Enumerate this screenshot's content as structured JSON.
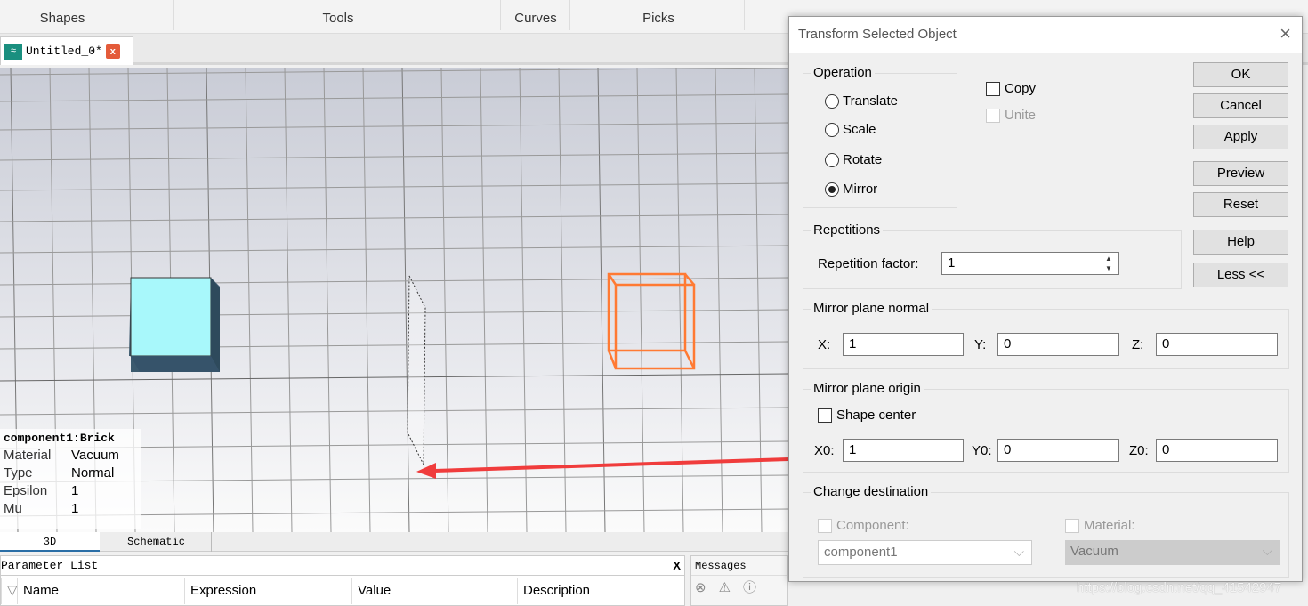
{
  "ribbon": {
    "groups": [
      "Shapes",
      "Tools",
      "Curves",
      "Picks"
    ]
  },
  "document_tab": {
    "title": "Untitled_0*",
    "close": "x"
  },
  "info_panel": {
    "title": "component1:Brick",
    "rows": [
      {
        "k": "Material",
        "v": "Vacuum"
      },
      {
        "k": "Type",
        "v": "Normal"
      },
      {
        "k": "Epsilon",
        "v": "1"
      },
      {
        "k": "Mu",
        "v": "1"
      }
    ]
  },
  "view_tabs": [
    "3D",
    "Schematic"
  ],
  "parameter_list": {
    "title": "Parameter List",
    "close": "X",
    "columns": [
      "Name",
      "Expression",
      "Value",
      "Description"
    ]
  },
  "messages": {
    "title": "Messages"
  },
  "colors": {
    "brick": "#a8f8fb",
    "selected": "#ff7a33",
    "arrow": "#f03c3c"
  },
  "dialog": {
    "title": "Transform Selected Object",
    "close": "×",
    "operation": {
      "label": "Operation",
      "options": [
        "Translate",
        "Scale",
        "Rotate",
        "Mirror"
      ],
      "selected": "Mirror"
    },
    "copy": {
      "label": "Copy",
      "checked": false
    },
    "unite": {
      "label": "Unite",
      "checked": false,
      "disabled": true
    },
    "buttons": [
      "OK",
      "Cancel",
      "Apply",
      "Preview",
      "Reset",
      "Help",
      "Less <<"
    ],
    "repetitions": {
      "label": "Repetitions",
      "factor_label": "Repetition factor:",
      "factor": "1"
    },
    "normal": {
      "label": "Mirror plane normal",
      "x_label": "X:",
      "x": "1",
      "y_label": "Y:",
      "y": "0",
      "z_label": "Z:",
      "z": "0"
    },
    "origin": {
      "label": "Mirror plane origin",
      "shape_center": "Shape center",
      "x_label": "X0:",
      "x": "1",
      "y_label": "Y0:",
      "y": "0",
      "z_label": "Z0:",
      "z": "0"
    },
    "destination": {
      "label": "Change destination",
      "component_label": "Component:",
      "component": "component1",
      "material_label": "Material:",
      "material": "Vacuum"
    }
  },
  "watermark": "https://blog.csdn.net/qq_41542947"
}
